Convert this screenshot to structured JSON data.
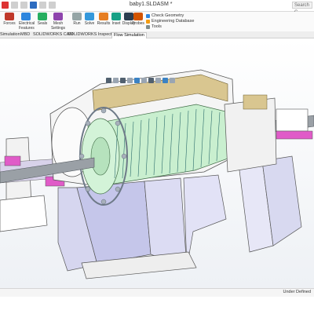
{
  "window": {
    "title": "baby1.SLDASM *",
    "search_text": "Search C"
  },
  "ribbon": {
    "buttons": [
      {
        "label": "Forces",
        "icon": "forces-icon",
        "color": "#c0392b"
      },
      {
        "label": "Electrical Features",
        "icon": "electrical-icon",
        "color": "#2e86de"
      },
      {
        "label": "Seals",
        "icon": "seals-icon",
        "color": "#27ae60"
      },
      {
        "label": "Mesh Settings",
        "icon": "mesh-icon",
        "color": "#8e44ad"
      },
      {
        "label": "Run",
        "icon": "run-icon",
        "color": "#95a5a6"
      },
      {
        "label": "Solve",
        "icon": "solve-icon",
        "color": "#3498db"
      },
      {
        "label": "Results",
        "icon": "results-icon",
        "color": "#e67e22"
      },
      {
        "label": "Inset",
        "icon": "inset-icon",
        "color": "#16a085"
      },
      {
        "label": "Display",
        "icon": "display-icon",
        "color": "#2c3e50"
      },
      {
        "label": "Probes",
        "icon": "probes-icon",
        "color": "#d35400"
      },
      {
        "label": "Screen Capture",
        "icon": "camera-icon",
        "color": "#7f8c8d"
      }
    ],
    "list": [
      {
        "label": "Check Geometry",
        "icon": "check-geometry-icon",
        "color": "#2e86de"
      },
      {
        "label": "Engineering Database",
        "icon": "database-icon",
        "color": "#f39c12"
      },
      {
        "label": "Tools",
        "icon": "tools-icon",
        "color": "#7f8c8d"
      }
    ]
  },
  "tabs": [
    {
      "label": "Simulation"
    },
    {
      "label": "MBD"
    },
    {
      "label": "SOLIDWORKS CAM"
    },
    {
      "label": "SOLIDWORKS Inspection"
    },
    {
      "label": "Flow Simulation",
      "active": true
    }
  ],
  "statusbar": {
    "units": "Under Defined"
  },
  "colors": {
    "hub_green": "#c9efcf",
    "bracket_lavender": "#d8d8ee",
    "housing_white": "#f3f3f3",
    "section_tan": "#d9c690",
    "accent_magenta": "#e05bc8",
    "shaft_steel": "#9aa0a6"
  }
}
